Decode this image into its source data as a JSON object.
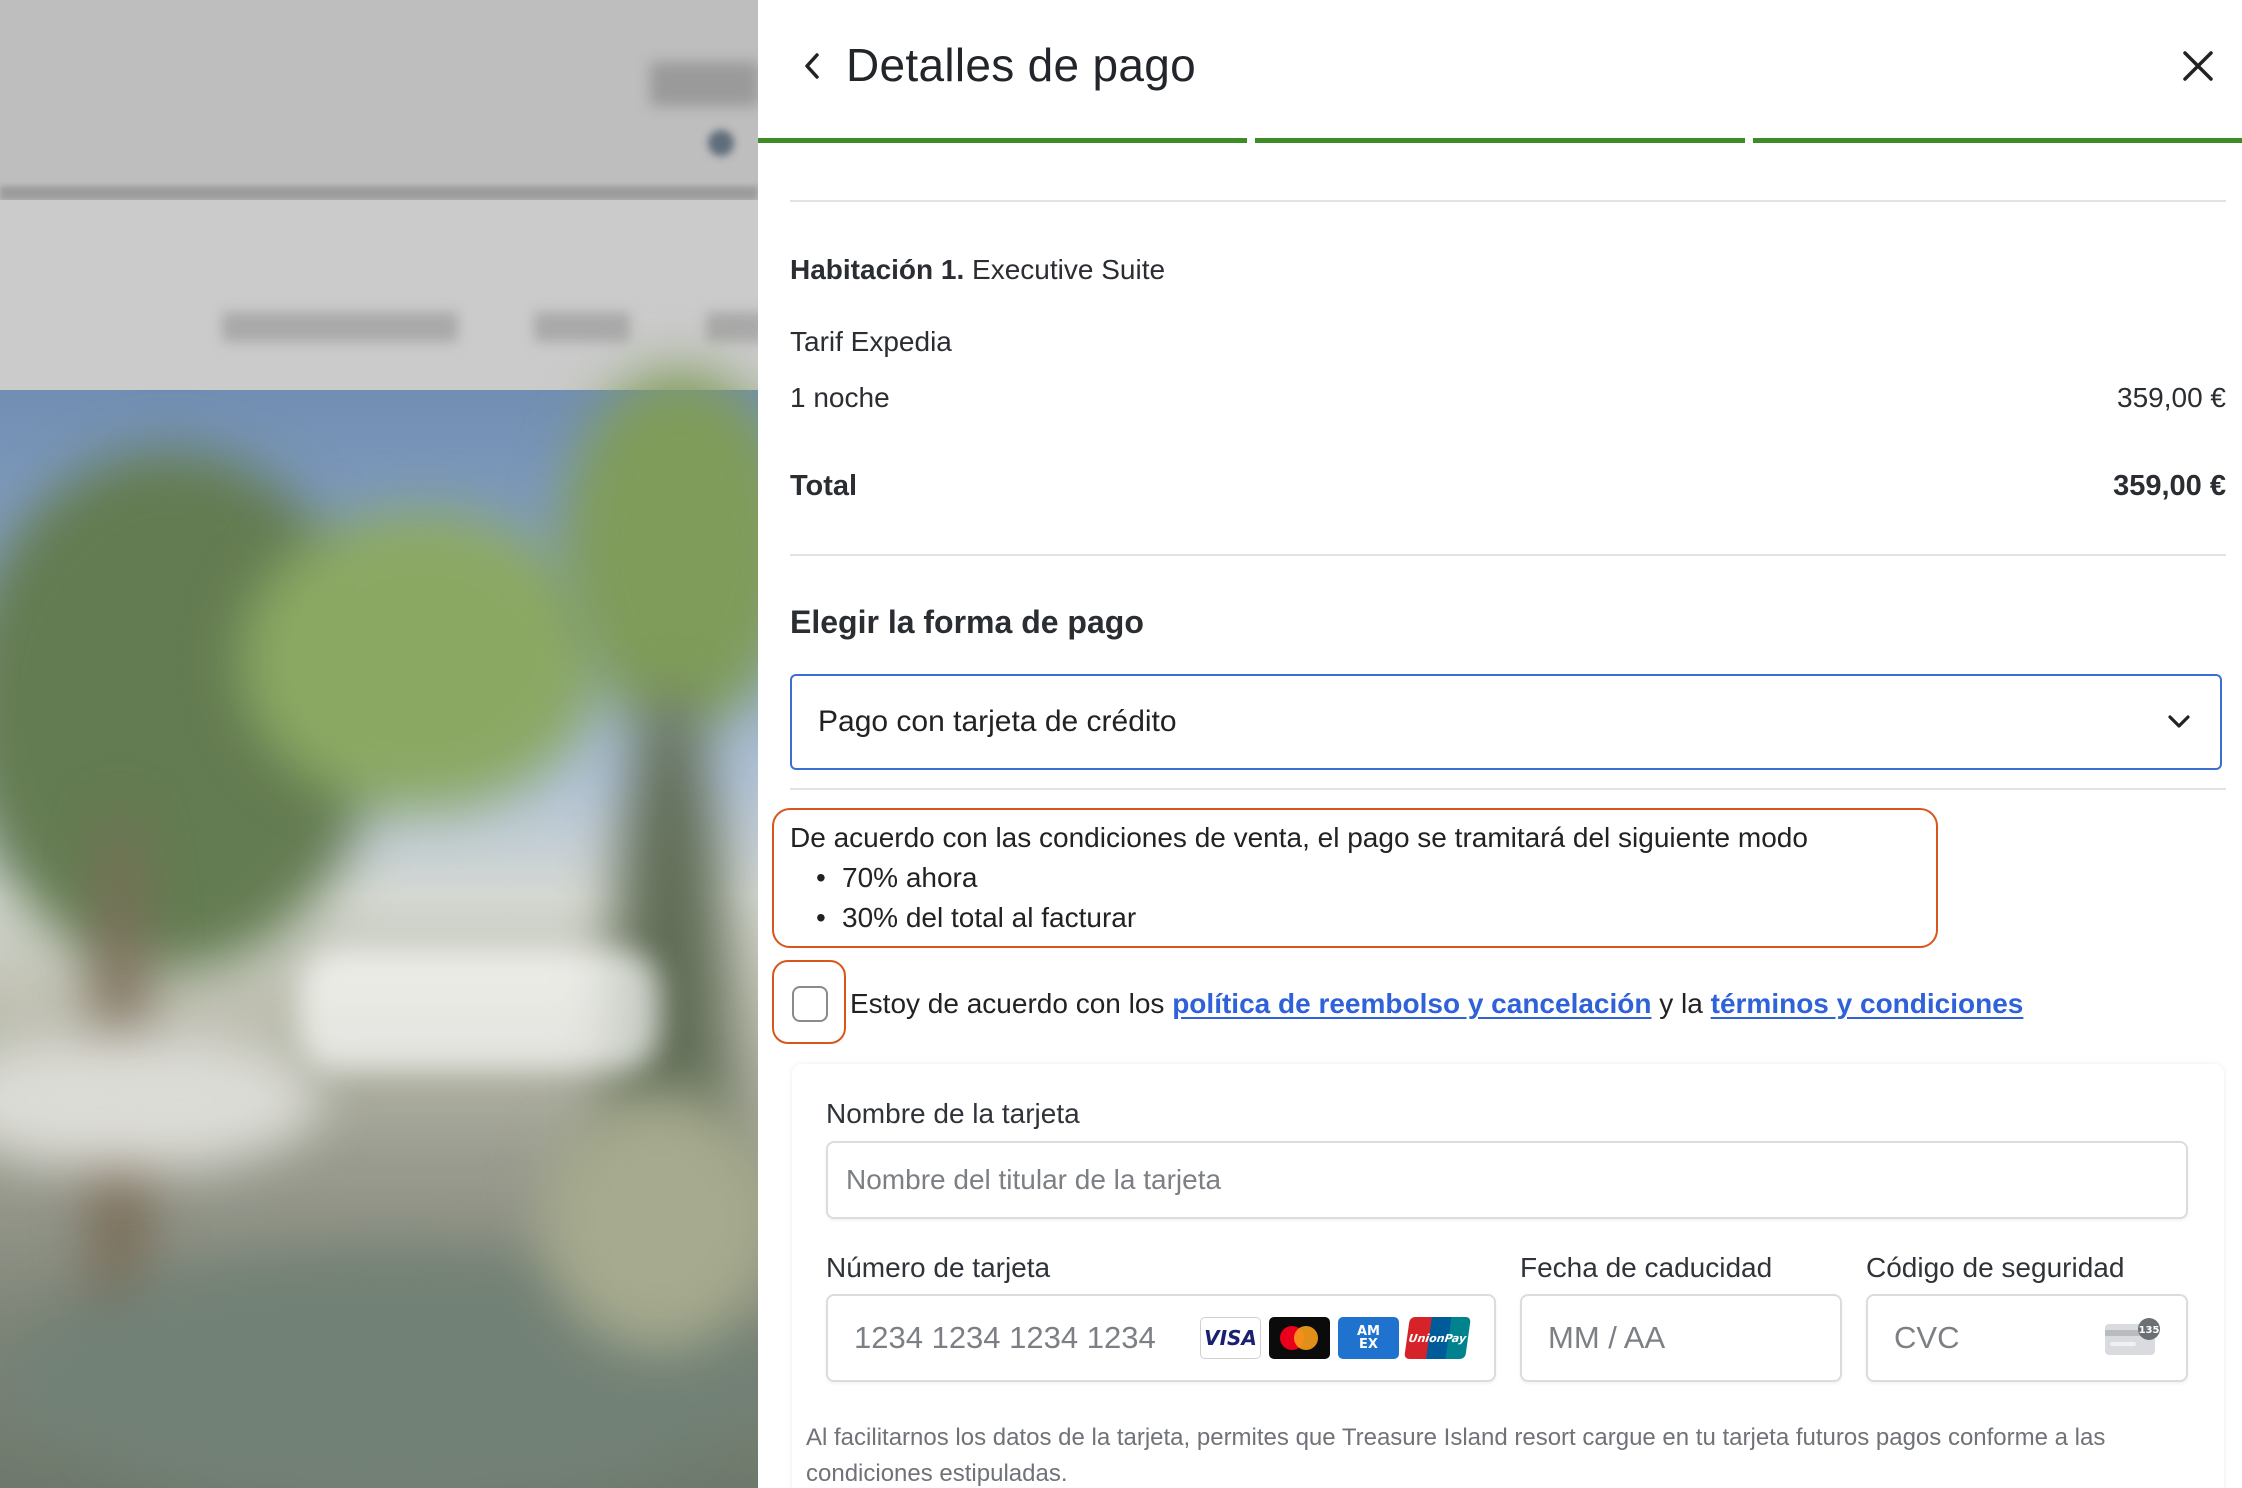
{
  "header": {
    "title": "Detalles de pago",
    "back_icon": "chevron-left-icon",
    "close_icon": "close-icon",
    "progress_steps_complete": 3,
    "progress_steps_total": 3,
    "accent_color": "#3d8c28"
  },
  "summary": {
    "room_label": "Habitación 1.",
    "room_name": "Executive Suite",
    "tariff": "Tarif Expedia",
    "nights_label": "1 noche",
    "nights_price": "359,00 €",
    "total_label": "Total",
    "total_price": "359,00 €"
  },
  "payment": {
    "section_title": "Elegir la forma de pago",
    "selected_method": "Pago con tarjeta de crédito",
    "dropdown_icon": "chevron-down-icon"
  },
  "conditions": {
    "intro": "De acuerdo con las condiciones de venta, el pago se tramitará del siguiente modo",
    "items": [
      "70% ahora",
      "30% del total al facturar"
    ],
    "highlight_color": "#d8561c"
  },
  "agreement": {
    "checked": false,
    "prefix": "Estoy de acuerdo con los ",
    "link1": "política de reembolso y cancelación",
    "middle": " y la ",
    "link2": "términos y condiciones",
    "link_color": "#2f62d8"
  },
  "card_form": {
    "name_label": "Nombre de la tarjeta",
    "name_placeholder": "Nombre del titular de la tarjeta",
    "number_label": "Número de tarjeta",
    "number_placeholder": "1234 1234 1234 1234",
    "brands": [
      "VISA",
      "Mastercard",
      "AMEX",
      "UnionPay"
    ],
    "expiry_label": "Fecha de caducidad",
    "expiry_placeholder": "MM / AA",
    "cvc_label": "Código de seguridad",
    "cvc_placeholder": "CVC",
    "cvc_icon": "card-cvc-icon",
    "disclaimer": "Al facilitarnos los datos de la tarjeta, permites que Treasure Island resort cargue en tu tarjeta futuros pagos conforme a las condiciones estipuladas."
  }
}
